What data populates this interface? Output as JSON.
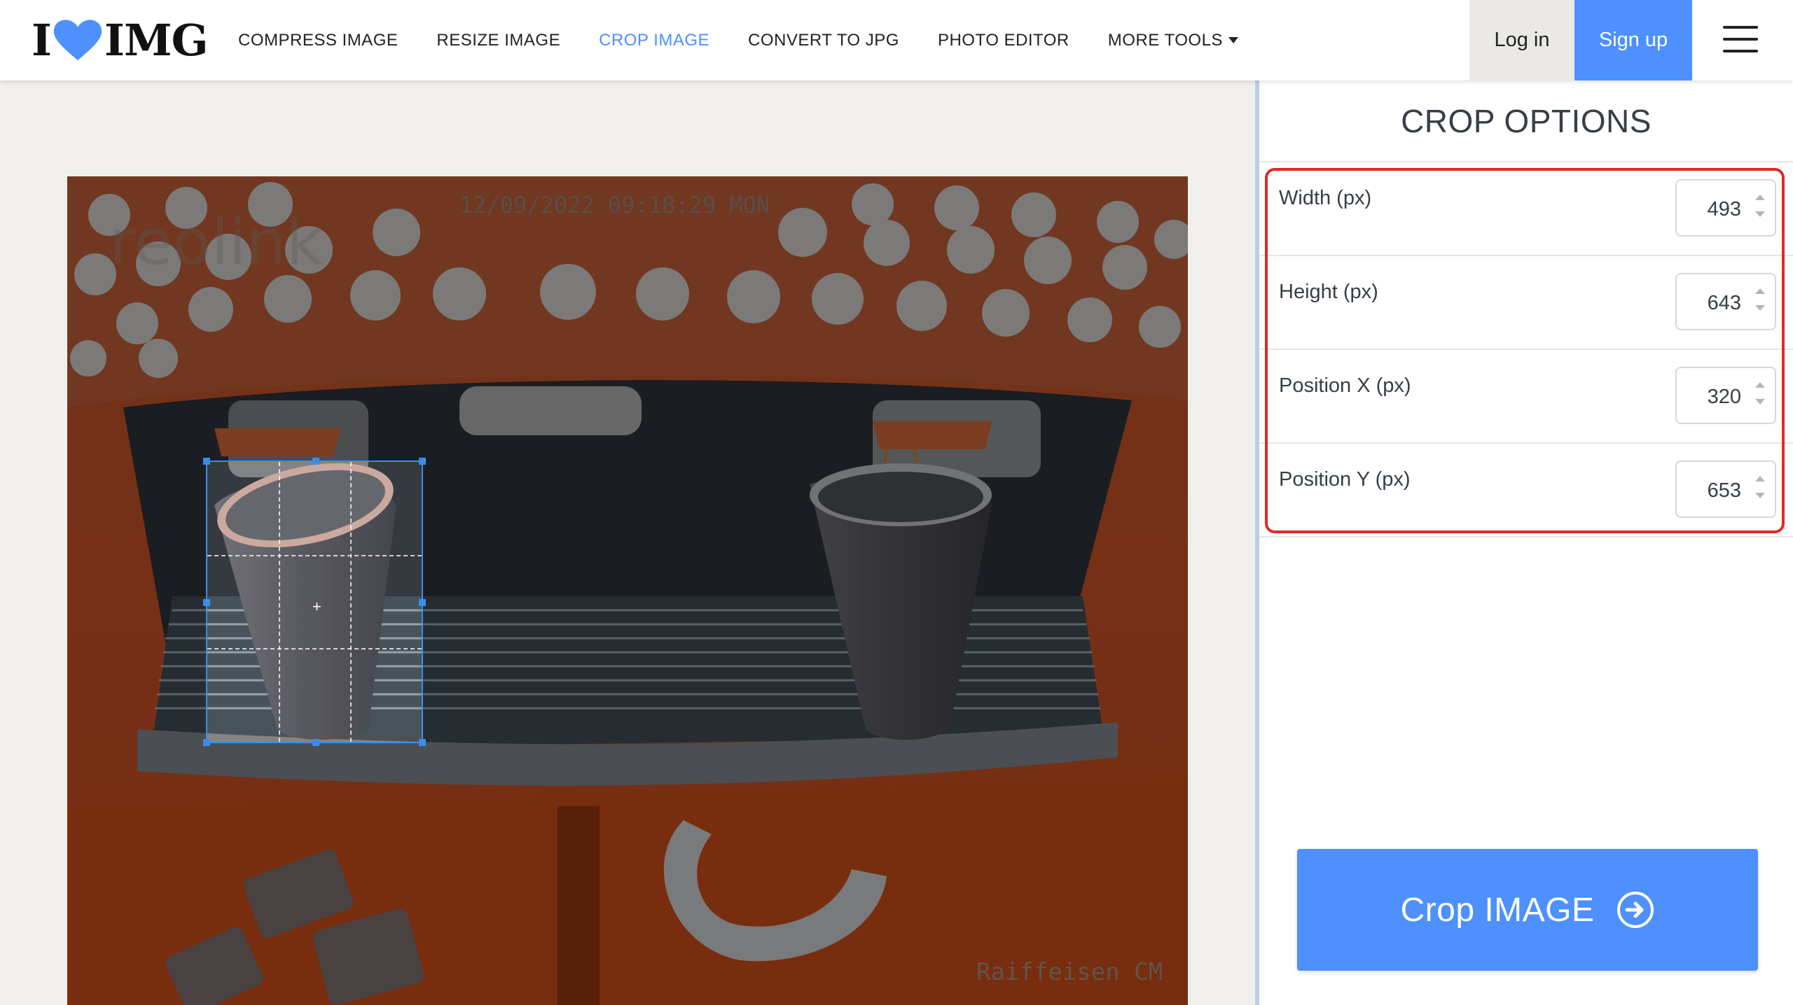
{
  "logo": {
    "left": "I",
    "right": "IMG"
  },
  "nav": [
    {
      "label": "COMPRESS IMAGE",
      "active": false
    },
    {
      "label": "RESIZE IMAGE",
      "active": false
    },
    {
      "label": "CROP IMAGE",
      "active": true
    },
    {
      "label": "CONVERT TO JPG",
      "active": false
    },
    {
      "label": "PHOTO EDITOR",
      "active": false
    },
    {
      "label": "MORE TOOLS",
      "active": false
    }
  ],
  "auth": {
    "login": "Log in",
    "signup": "Sign up"
  },
  "sidebar": {
    "title": "CROP OPTIONS",
    "fields": [
      {
        "label": "Width (px)",
        "value": "493"
      },
      {
        "label": "Height (px)",
        "value": "643"
      },
      {
        "label": "Position X (px)",
        "value": "320"
      },
      {
        "label": "Position Y (px)",
        "value": "653"
      }
    ],
    "action": "Crop IMAGE"
  },
  "image": {
    "timestamp": "12/09/2022 09:18:29 MON",
    "watermark": "reolink",
    "caption": "Raiffeisen CM"
  },
  "colors": {
    "accent": "#4d90fe",
    "highlight": "#e02828",
    "cropGuide": "#3b8ee8"
  }
}
